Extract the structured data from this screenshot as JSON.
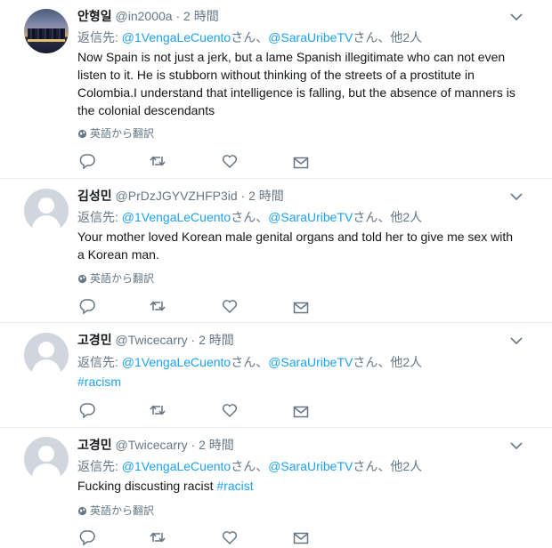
{
  "reply_prefix": "返信先: ",
  "reply_separator": "さん、",
  "reply_suffix": "さん、他2人",
  "dot": "·",
  "translate_label": "英語から翻訳",
  "colors": {
    "link": "#1da1f2",
    "secondary": "#657786",
    "text": "#14171a"
  },
  "icons": [
    "chevron-down-icon",
    "globe-icon",
    "reply-icon",
    "retweet-icon",
    "like-icon",
    "message-icon"
  ],
  "tweets": [
    {
      "name": "안형일",
      "handle": "@in2000a",
      "time": "2 時間",
      "mention1": "@1VengaLeCuento",
      "mention2": "@SaraUribeTV",
      "text": "Now Spain is not just a jerk, but a lame Spanish illegitimate who can not even listen to it. He is stubborn without thinking of the streets of a prostitute in Colombia.I understand that intelligence is falling, but the absence of manners is the colonial descendants"
    },
    {
      "name": "김성민",
      "handle": "@PrDzJGYVZHFP3id",
      "time": "2 時間",
      "mention1": "@1VengaLeCuento",
      "mention2": "@SaraUribeTV",
      "text": "Your mother loved Korean male genital organs and told her to give me sex with a Korean man."
    },
    {
      "name": "고경민",
      "handle": "@Twicecarry",
      "time": "2 時間",
      "mention1": "@1VengaLeCuento",
      "mention2": "@SaraUribeTV",
      "hashtag": "#racism"
    },
    {
      "name": "고경민",
      "handle": "@Twicecarry",
      "time": "2 時間",
      "mention1": "@1VengaLeCuento",
      "mention2": "@SaraUribeTV",
      "text": "Fucking discusting racist ",
      "hashtag": "#racist"
    }
  ]
}
